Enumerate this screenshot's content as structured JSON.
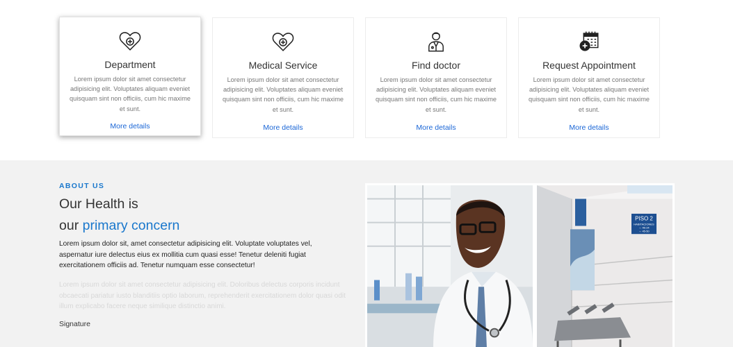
{
  "services": {
    "cards": [
      {
        "title": "Department",
        "text": "Lorem ipsum dolor sit amet consectetur adipisicing elit. Voluptates aliquam eveniet quisquam sint non officiis, cum hic maxime et sunt.",
        "link": "More details",
        "icon": "heart-plus-icon"
      },
      {
        "title": "Medical Service",
        "text": "Lorem ipsum dolor sit amet consectetur adipisicing elit. Voluptates aliquam eveniet quisquam sint non officiis, cum hic maxime et sunt.",
        "link": "More details",
        "icon": "heart-plus-icon"
      },
      {
        "title": "Find doctor",
        "text": "Lorem ipsum dolor sit amet consectetur adipisicing elit. Voluptates aliquam eveniet quisquam sint non officiis, cum hic maxime et sunt.",
        "link": "More details",
        "icon": "doctor-icon"
      },
      {
        "title": "Request Appointment",
        "text": "Lorem ipsum dolor sit amet consectetur adipisicing elit. Voluptates aliquam eveniet quisquam sint non officiis, cum hic maxime et sunt.",
        "link": "More details",
        "icon": "calendar-plus-icon"
      }
    ]
  },
  "about": {
    "eyebrow": "ABOUT US",
    "heading_line1": "Our Health is",
    "heading_line2_prefix": "our",
    "heading_line2_accent": "primary concern",
    "lead": "Lorem ipsum dolor sit, amet consectetur adipisicing elit. Voluptate voluptates vel, aspernatur iure delectus eius ex mollitia cum quasi esse! Tenetur deleniti fugiat exercitationem officiis ad. Tenetur numquam esse consectetur!",
    "muted": "Lorem ipsum dolor sit amet consectetur adipisicing elit. Doloribus delectus corporis incidunt obcaecati pariatur iusto blanditiis optio laborum, reprehenderit exercitationem dolor quasi odit illum explicabo facere neque similique distinctio animi.",
    "signature": "Signature",
    "sign_text": "PISO 2",
    "sign_lines": [
      "HABITACIONES",
      "→ 46-24",
      "→ 45-50"
    ]
  },
  "colors": {
    "accent": "#1977cc",
    "link": "#1a66d6",
    "about_bg": "#f2f2f2"
  }
}
